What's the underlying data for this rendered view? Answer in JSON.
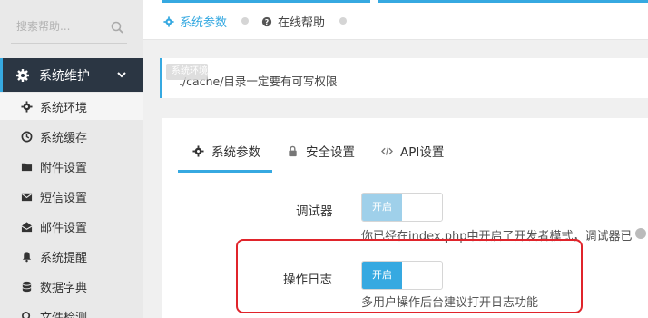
{
  "sidebar": {
    "search_placeholder": "搜索帮助...",
    "group_label": "系统维护",
    "items": [
      {
        "label": "系统环境",
        "icon": "gear-icon"
      },
      {
        "label": "系统缓存",
        "icon": "clock-icon"
      },
      {
        "label": "附件设置",
        "icon": "folder-icon"
      },
      {
        "label": "短信设置",
        "icon": "envelope-icon"
      },
      {
        "label": "邮件设置",
        "icon": "envelope-open-icon"
      },
      {
        "label": "系统提醒",
        "icon": "bell-icon"
      },
      {
        "label": "数据字典",
        "icon": "database-icon"
      },
      {
        "label": "文件检测",
        "icon": "search-icon"
      }
    ]
  },
  "topbar": {
    "tabs": [
      {
        "label": "系统参数",
        "icon": "gear-icon"
      },
      {
        "label": "在线帮助",
        "icon": "question-icon"
      }
    ]
  },
  "notice": {
    "text": "./cache/目录一定要有可写权限",
    "tooltip": "系统环境"
  },
  "card": {
    "tabs": [
      {
        "label": "系统参数",
        "icon": "gear-icon"
      },
      {
        "label": "安全设置",
        "icon": "lock-icon"
      },
      {
        "label": "API设置",
        "icon": "code-icon"
      }
    ],
    "fields": [
      {
        "label": "调试器",
        "switch_on_label": "开启",
        "hint": "你已经在index.php中开启了开发者模式，调试器已"
      },
      {
        "label": "操作日志",
        "switch_on_label": "开启",
        "hint": "多用户操作后台建议打开日志功能"
      }
    ]
  },
  "colors": {
    "accent": "#36a9e1",
    "sidebar_dark": "#2b3643",
    "highlight": "#e0242b"
  }
}
